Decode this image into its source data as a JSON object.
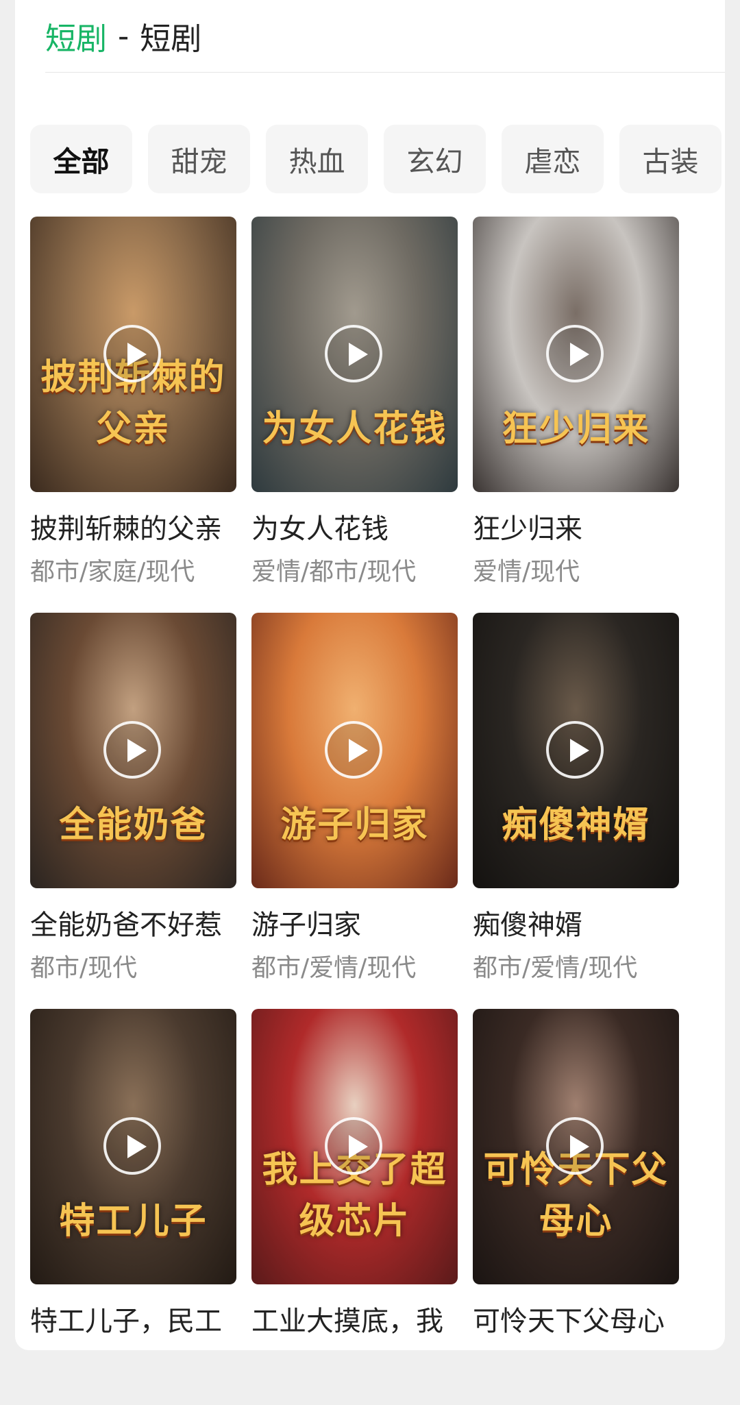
{
  "header": {
    "category": "短剧",
    "separator": "-",
    "subtitle": "短剧"
  },
  "tabs": [
    "全部",
    "甜宠",
    "热血",
    "玄幻",
    "虐恋",
    "古装"
  ],
  "active_tab": "全部",
  "dramas": [
    {
      "title": "披荆斩棘的父亲",
      "tags": "都市/家庭/现代",
      "poster_text": "披荆斩棘的父亲",
      "colors": [
        "#8a6a4a",
        "#c99a68",
        "#3a2a1e"
      ]
    },
    {
      "title": "为女人花钱",
      "tags": "爱情/都市/现代",
      "poster_text": "为女人花钱",
      "colors": [
        "#6e6a62",
        "#a19a8e",
        "#2e3a3e"
      ]
    },
    {
      "title": "狂少归来",
      "tags": "爱情/现代",
      "poster_text": "狂少归来",
      "colors": [
        "#c8c4c0",
        "#7a6e66",
        "#3a3432"
      ]
    },
    {
      "title": "全能奶爸不好惹",
      "tags": "都市/现代",
      "poster_text": "全能奶爸",
      "colors": [
        "#6a4a34",
        "#c2a080",
        "#2a2420"
      ]
    },
    {
      "title": "游子归家",
      "tags": "都市/爱情/现代",
      "poster_text": "游子归家",
      "colors": [
        "#d97a3a",
        "#f0b070",
        "#6a2a1a"
      ]
    },
    {
      "title": "痴傻神婿",
      "tags": "都市/爱情/现代",
      "poster_text": "痴傻神婿",
      "colors": [
        "#2a2622",
        "#6a5a4a",
        "#141210"
      ]
    },
    {
      "title": "特工儿子，民工",
      "tags": "",
      "poster_text": "特工儿子",
      "colors": [
        "#4a3a2e",
        "#8a7058",
        "#221a14"
      ]
    },
    {
      "title": "工业大摸底，我",
      "tags": "",
      "poster_text": "我上交了超级芯片",
      "colors": [
        "#b02a2a",
        "#e8d0c0",
        "#5a1a1a"
      ]
    },
    {
      "title": "可怜天下父母心",
      "tags": "",
      "poster_text": "可怜天下父母心",
      "colors": [
        "#3a2a24",
        "#a08070",
        "#1a1412"
      ]
    }
  ]
}
